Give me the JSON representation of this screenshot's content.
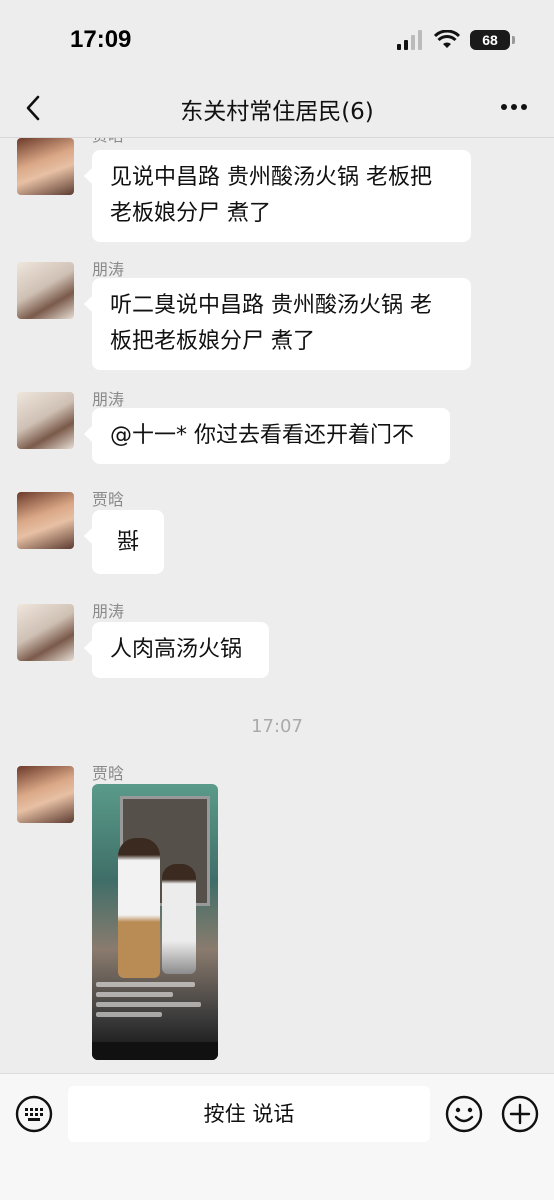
{
  "status": {
    "time": "17:09",
    "battery": "68",
    "icons": [
      "cellular-signal-icon",
      "wifi-icon",
      "battery-icon"
    ]
  },
  "nav": {
    "title": "东关村常住居民(6)",
    "back_icon": "chevron-left-icon",
    "more_icon": "ellipsis-icon"
  },
  "messages": [
    {
      "sender": "贾晗",
      "text1": "见说中昌路 贵州酸汤火锅 老板把",
      "text2": "老板娘分尸 煮了"
    },
    {
      "sender": "朋涛",
      "text1": "听二臭说中昌路 贵州酸汤火锅 老",
      "text2": "板把老板娘分尸 煮了"
    },
    {
      "sender": "朋涛",
      "text1": "@十一* 你过去看看还开着门不"
    },
    {
      "sender": "贾晗",
      "text1": "揺"
    },
    {
      "sender": "朋涛",
      "text1": "人肉高汤火锅"
    },
    {
      "sender": "贾晗",
      "media": "video"
    }
  ],
  "timestamp": "17:07",
  "input": {
    "talk_label": "按住 说话",
    "keyboard_icon": "keyboard-icon",
    "emoji_icon": "emoji-icon",
    "plus_icon": "plus-circle-icon"
  },
  "colors": {
    "background": "#ededed",
    "bubble": "#ffffff",
    "sender_name": "#8a8a8a"
  }
}
